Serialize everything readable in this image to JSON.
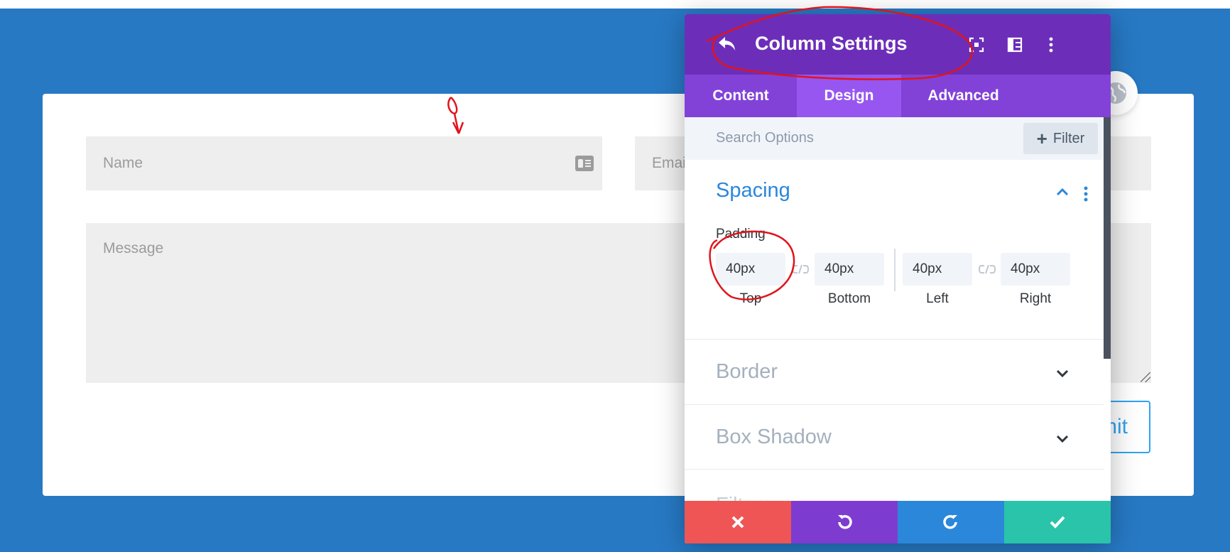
{
  "form": {
    "name_placeholder": "Name",
    "email_placeholder": "Email",
    "message_placeholder": "Message",
    "submit_label": "Submit"
  },
  "panel": {
    "title": "Column Settings",
    "tabs": [
      {
        "label": "Content",
        "active": false
      },
      {
        "label": "Design",
        "active": true
      },
      {
        "label": "Advanced",
        "active": false
      }
    ],
    "search_placeholder": "Search Options",
    "filter_label": "Filter",
    "sections": {
      "spacing": {
        "title": "Spacing",
        "expanded": true,
        "padding_label": "Padding",
        "fields": [
          {
            "label": "Top",
            "value": "40px"
          },
          {
            "label": "Bottom",
            "value": "40px"
          },
          {
            "label": "Left",
            "value": "40px"
          },
          {
            "label": "Right",
            "value": "40px"
          }
        ]
      },
      "border": {
        "title": "Border",
        "expanded": false
      },
      "box_shadow": {
        "title": "Box Shadow",
        "expanded": false
      },
      "filters": {
        "title": "Filters",
        "expanded": false
      }
    },
    "footer": {
      "cancel_icon": "close-icon",
      "undo_icon": "undo-icon",
      "redo_icon": "redo-icon",
      "save_icon": "checkmark-icon"
    }
  },
  "colors": {
    "page_bg": "#2779c4",
    "header_purple": "#6c2eb9",
    "tabs_purple": "#8242d8",
    "active_tab": "#9756f0",
    "accent_blue": "#2b87da",
    "cancel_red": "#ef5555",
    "save_green": "#29c4a9",
    "annotation_red": "#e0141b"
  }
}
